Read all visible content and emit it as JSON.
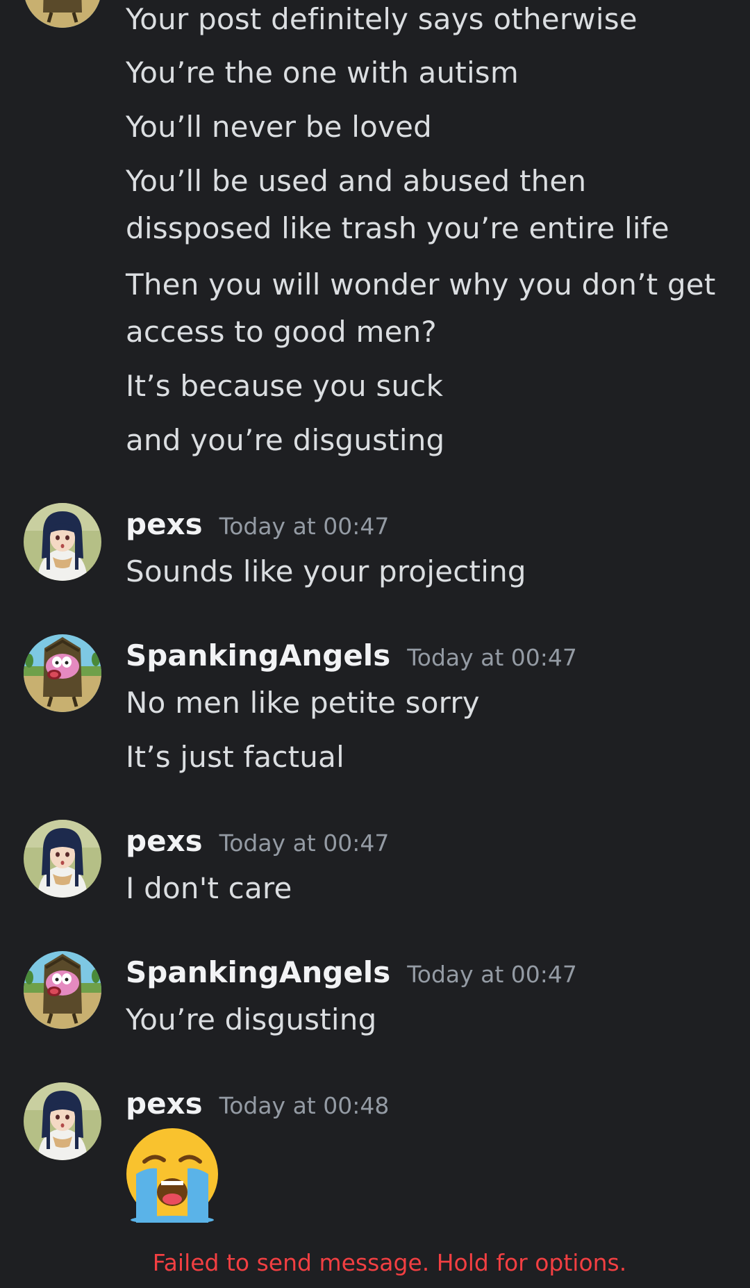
{
  "messages": {
    "top_block": {
      "lines": [
        "Your post definitely says otherwise",
        "You’re the one with autism",
        "You’ll never be loved",
        "You’ll be used and abused then",
        "dissposed like trash you’re entire life",
        "Then you will wonder why you don’t get",
        "access to good men?",
        "It’s because you suck",
        "and you’re disgusting"
      ]
    },
    "m1": {
      "username": "pexs",
      "timestamp": "Today at 00:47",
      "lines": [
        "Sounds like your projecting"
      ]
    },
    "m2": {
      "username": "SpankingAngels",
      "timestamp": "Today at 00:47",
      "lines": [
        "No men like petite sorry",
        "It’s just factual"
      ]
    },
    "m3": {
      "username": "pexs",
      "timestamp": "Today at 00:47",
      "lines": [
        "I don't care"
      ]
    },
    "m4": {
      "username": "SpankingAngels",
      "timestamp": "Today at 00:47",
      "lines": [
        "You’re disgusting"
      ]
    },
    "m5": {
      "username": "pexs",
      "timestamp": "Today at 00:48",
      "emoji": "loudly-crying-face"
    }
  },
  "status": {
    "failed_send": "Failed to send message. Hold for options."
  },
  "colors": {
    "background": "#1e1f22",
    "message_text": "#dbdee1",
    "username": "#f2f3f5",
    "timestamp": "#949ba4",
    "error": "#f23f42"
  },
  "icons": {
    "avatar_pexs": "anime-girl-avatar-icon",
    "avatar_spankingangels": "courage-dog-avatar-icon"
  }
}
